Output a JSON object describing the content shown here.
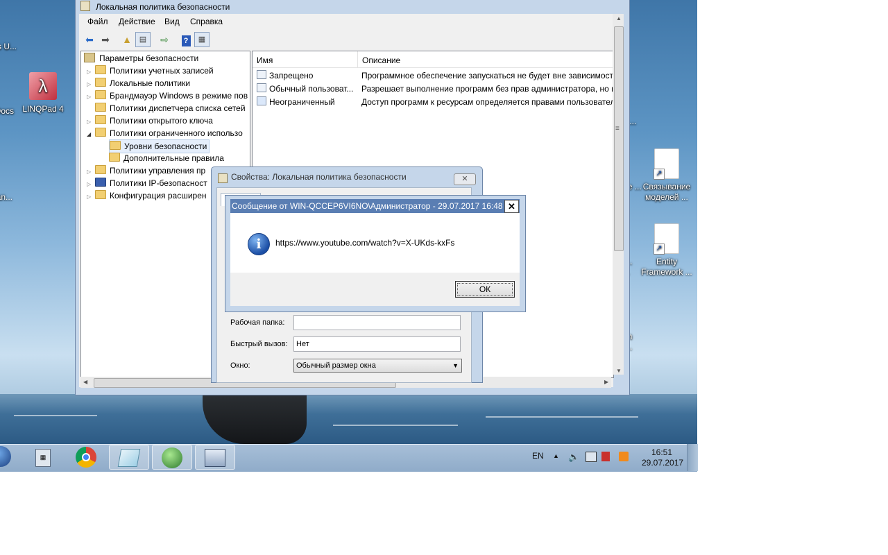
{
  "window": {
    "title": "Локальная политика безопасности",
    "menu": [
      "Файл",
      "Действие",
      "Вид",
      "Справка"
    ],
    "toolbar": [
      "back-icon",
      "forward-icon",
      "up-folder-icon",
      "show-hide-tree-icon",
      "export-icon",
      "help-icon",
      "properties-icon"
    ]
  },
  "tree": {
    "root": "Параметры безопасности",
    "items": [
      "Политики учетных записей",
      "Локальные политики",
      "Брандмауэр Windows в режиме пов",
      "Политики диспетчера списка сетей",
      "Политики открытого ключа",
      "Политики ограниченного использо",
      "Уровни безопасности",
      "Дополнительные правила",
      "Политики управления пр",
      "Политики IP-безопасност",
      "Конфигурация расширен"
    ]
  },
  "list": {
    "columns": [
      "Имя",
      "Описание"
    ],
    "rows": [
      {
        "name": "Запрещено",
        "desc": "Программное обеспечение запускаться не будет вне зависимост"
      },
      {
        "name": "Обычный пользоват...",
        "desc": "Разрешает выполнение программ без прав администратора, но п"
      },
      {
        "name": "Неограниченный",
        "desc": "Доступ программ к ресурсам определяется правами пользовател"
      }
    ]
  },
  "properties": {
    "title": "Свойства: Локальная политика безопасности",
    "close": "✕",
    "workdir_label": "Рабочая папка:",
    "workdir_value": "",
    "hotkey_label": "Быстрый вызов:",
    "hotkey_value": "Нет",
    "window_label": "Окно:",
    "window_value": "Обычный размер окна"
  },
  "message": {
    "title": "Сообщение от WIN-QCCEP6VI6NO\\Администратор - 29.07.2017 16:48",
    "close": "✕",
    "text": "https://www.youtube.com/watch?v=X-UKds-kxFs",
    "ok": "ОК"
  },
  "desktop": {
    "icons": [
      {
        "label": "LINQPad 4"
      },
      {
        "label": "Связывание моделей ..."
      },
      {
        "label": "Entity Framework ..."
      }
    ],
    "fragments": [
      "s U...",
      "Docs",
      "an...",
      "k ...",
      "ие ...",
      "t...",
      "...",
      "on",
      "r..."
    ]
  },
  "taskbar": {
    "lang": "EN",
    "time": "16:51",
    "date": "29.07.2017"
  }
}
